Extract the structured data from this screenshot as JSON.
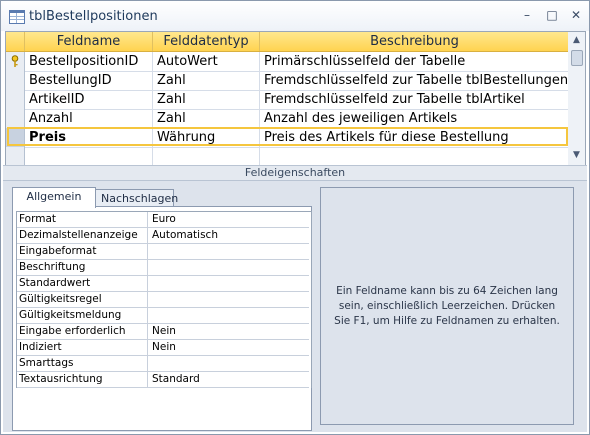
{
  "window": {
    "title": "tblBestellpositionen",
    "minimize": "–",
    "maximize": "□",
    "close": "✕"
  },
  "grid": {
    "columns": [
      "Feldname",
      "Felddatentyp",
      "Beschreibung"
    ],
    "rows": [
      {
        "name": "BestellpositionID",
        "type": "AutoWert",
        "desc": "Primärschlüsselfeld der Tabelle",
        "primary_key": true
      },
      {
        "name": "BestellungID",
        "type": "Zahl",
        "desc": "Fremdschlüsselfeld zur Tabelle tblBestellungen"
      },
      {
        "name": "ArtikelID",
        "type": "Zahl",
        "desc": "Fremdschlüsselfeld zur Tabelle tblArtikel"
      },
      {
        "name": "Anzahl",
        "type": "Zahl",
        "desc": "Anzahl des jeweiligen Artikels"
      },
      {
        "name": "Preis",
        "type": "Währung",
        "desc": "Preis des Artikels für diese Bestellung",
        "active": true
      },
      {
        "name": "",
        "type": "",
        "desc": ""
      }
    ],
    "scroll_up": "▲",
    "scroll_down": "▼"
  },
  "field_properties": {
    "title": "Feldeigenschaften",
    "tabs": [
      "Allgemein",
      "Nachschlagen"
    ],
    "properties": [
      {
        "label": "Format",
        "value": "Euro"
      },
      {
        "label": "Dezimalstellenanzeige",
        "value": "Automatisch"
      },
      {
        "label": "Eingabeformat",
        "value": ""
      },
      {
        "label": "Beschriftung",
        "value": ""
      },
      {
        "label": "Standardwert",
        "value": ""
      },
      {
        "label": "Gültigkeitsregel",
        "value": ""
      },
      {
        "label": "Gültigkeitsmeldung",
        "value": ""
      },
      {
        "label": "Eingabe erforderlich",
        "value": "Nein"
      },
      {
        "label": "Indiziert",
        "value": "Nein"
      },
      {
        "label": "Smarttags",
        "value": ""
      },
      {
        "label": "Textausrichtung",
        "value": "Standard"
      }
    ],
    "help_text": "Ein Feldname kann bis zu 64 Zeichen lang sein, einschließlich Leerzeichen. Drücken Sie F1, um Hilfe zu Feldnamen zu erhalten."
  },
  "colors": {
    "header_gold": "#ffd350",
    "active_row_outline": "#f5c63e",
    "title_text": "#1e395b"
  }
}
